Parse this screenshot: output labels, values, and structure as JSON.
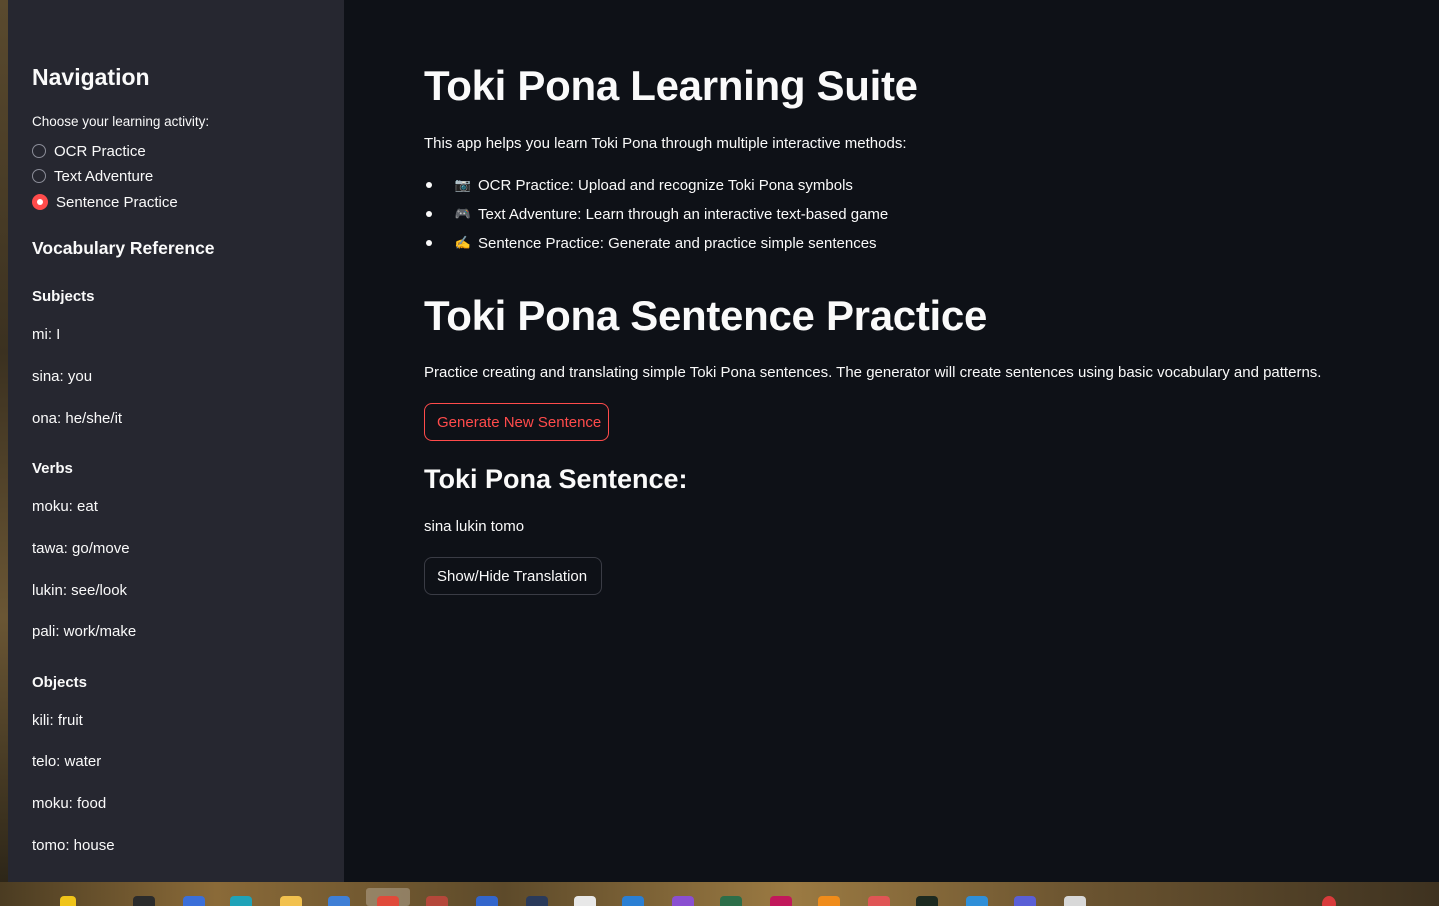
{
  "sidebar": {
    "title": "Navigation",
    "radio_label": "Choose your learning activity:",
    "options": [
      "OCR Practice",
      "Text Adventure",
      "Sentence Practice"
    ],
    "selected_option": "Sentence Practice",
    "vocab_title": "Vocabulary Reference",
    "sections": [
      {
        "heading": "Subjects",
        "items": [
          "mi: I",
          "sina: you",
          "ona: he/she/it"
        ]
      },
      {
        "heading": "Verbs",
        "items": [
          "moku: eat",
          "tawa: go/move",
          "lukin: see/look",
          "pali: work/make"
        ]
      },
      {
        "heading": "Objects",
        "items": [
          "kili: fruit",
          "telo: water",
          "moku: food",
          "tomo: house"
        ]
      }
    ]
  },
  "main": {
    "title": "Toki Pona Learning Suite",
    "intro": "This app helps you learn Toki Pona through multiple interactive methods:",
    "features": [
      {
        "icon": "camera-icon",
        "glyph": "📷",
        "text": "OCR Practice: Upload and recognize Toki Pona symbols"
      },
      {
        "icon": "game-controller-icon",
        "glyph": "🎮",
        "text": "Text Adventure: Learn through an interactive text-based game"
      },
      {
        "icon": "writing-hand-icon",
        "glyph": "✍",
        "text": "Sentence Practice: Generate and practice simple sentences"
      }
    ],
    "section_title": "Toki Pona Sentence Practice",
    "section_desc": "Practice creating and translating simple Toki Pona sentences. The generator will create sentences using basic vocabulary and patterns.",
    "generate_button": "Generate New Sentence",
    "sentence_heading": "Toki Pona Sentence:",
    "sentence": "sina lukin tomo",
    "toggle_button": "Show/Hide Translation"
  },
  "colors": {
    "background": "#0e1117",
    "sidebar": "#262730",
    "accent": "#ff4b4b",
    "text": "#fafafa"
  }
}
